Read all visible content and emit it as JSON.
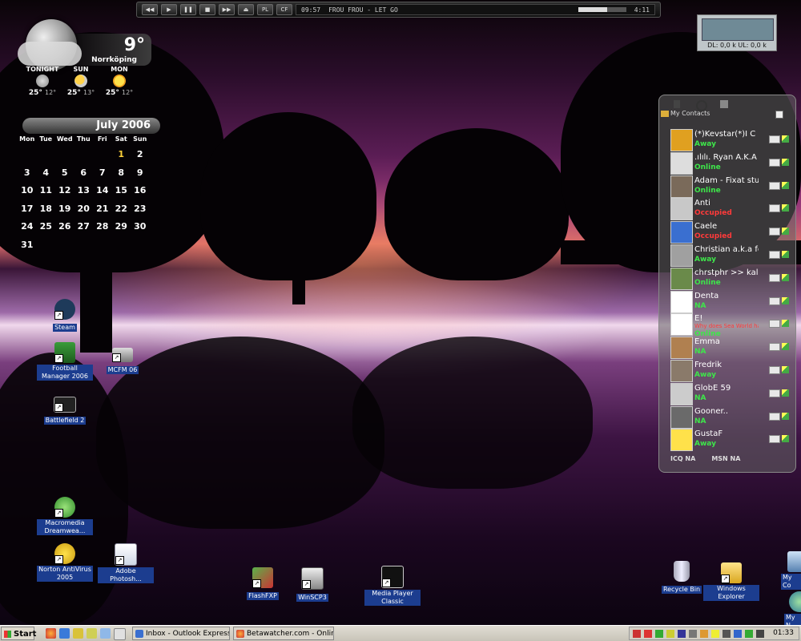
{
  "player": {
    "buttons": [
      "◀◀",
      "▶",
      "❚❚",
      "■",
      "▶▶",
      "⏏"
    ],
    "mode_buttons": [
      "PL",
      "CF"
    ],
    "elapsed": "09:57",
    "track": "FROU FROU - LET GO",
    "total": "4:11"
  },
  "netmeter": {
    "label": "DL: 0,0 k   UL: 0,0 k"
  },
  "weather": {
    "temp": "9°",
    "city": "Norrköping",
    "forecast": [
      {
        "label": "TONIGHT",
        "high": "25°",
        "low": "12°",
        "icon": "cloudy-night-icon"
      },
      {
        "label": "SUN",
        "high": "25°",
        "low": "13°",
        "icon": "partly-sunny-icon"
      },
      {
        "label": "MON",
        "high": "25°",
        "low": "12°",
        "icon": "sunny-icon"
      }
    ]
  },
  "calendar": {
    "month": "July 2006",
    "weekdays": [
      "Mon",
      "Tue",
      "Wed",
      "Thu",
      "Fri",
      "Sat",
      "Sun"
    ],
    "weeks": [
      [
        "",
        "",
        "",
        "",
        "",
        "1",
        "2"
      ],
      [
        "3",
        "4",
        "5",
        "6",
        "7",
        "8",
        "9"
      ],
      [
        "10",
        "11",
        "12",
        "13",
        "14",
        "15",
        "16"
      ],
      [
        "17",
        "18",
        "19",
        "20",
        "21",
        "22",
        "23"
      ],
      [
        "24",
        "25",
        "26",
        "27",
        "28",
        "29",
        "30"
      ],
      [
        "31",
        "",
        "",
        "",
        "",
        "",
        ""
      ]
    ],
    "today": "1"
  },
  "icons": {
    "steam": "Steam",
    "fm2006": "Football Manager 2006",
    "mcfm": "MCFM 06",
    "bf2": "Battlefield 2",
    "dreamweaver": "Macromedia Dreamwea...",
    "norton": "Norton AntiVirus 2005",
    "photoshop": "Adobe Photosh...",
    "flashfxp": "FlashFXP",
    "winscp": "WinSCP3",
    "mpc": "Media Player Classic",
    "recycle": "Recycle Bin",
    "explorer": "Windows Explorer",
    "mycomputer": "My Co",
    "mynetwork": "My N"
  },
  "contacts": {
    "group": "My Contacts",
    "list": [
      {
        "name": "(*)Kevstar(*)I C",
        "status": "Away",
        "mood": ""
      },
      {
        "name": ".ılılı. Ryan A.K.A",
        "status": "Online",
        "mood": ""
      },
      {
        "name": "Adam - Fixat stu",
        "status": "Online",
        "mood": ""
      },
      {
        "name": "Anti",
        "status": "Occupied",
        "mood": ""
      },
      {
        "name": "Caele",
        "status": "Occupied",
        "mood": ""
      },
      {
        "name": "Christian a.k.a fe",
        "status": "Away",
        "mood": ""
      },
      {
        "name": "chrstphr >> kall",
        "status": "Online",
        "mood": ""
      },
      {
        "name": "Denta",
        "status": "NA",
        "mood": ""
      },
      {
        "name": "E!",
        "status": "Online",
        "mood": "Why does Sea World hav"
      },
      {
        "name": "Emma",
        "status": "NA",
        "mood": ""
      },
      {
        "name": "Fredrik",
        "status": "Away",
        "mood": ""
      },
      {
        "name": "GlobE 59",
        "status": "NA",
        "mood": ""
      },
      {
        "name": "Gooner..",
        "status": "NA",
        "mood": ""
      },
      {
        "name": "GustaF",
        "status": "Away",
        "mood": ""
      }
    ],
    "footer_icq": "ICQ NA",
    "footer_msn": "MSN NA"
  },
  "taskbar": {
    "start": "Start",
    "tasks": [
      "Inbox - Outlook Express",
      "Betawatcher.com - Online..."
    ],
    "clock": "01:33"
  }
}
